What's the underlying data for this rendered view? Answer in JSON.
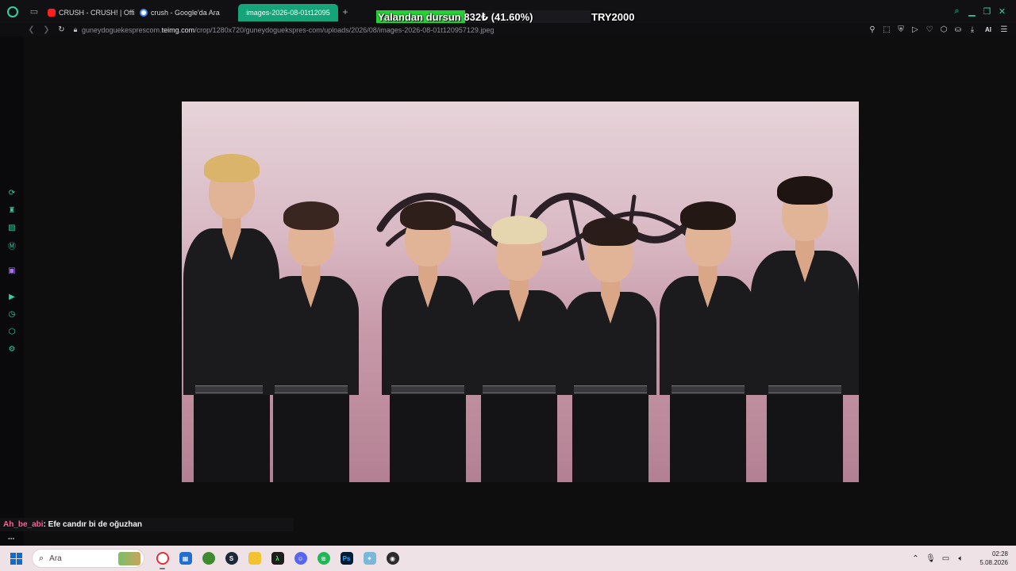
{
  "browser": {
    "tabs": [
      {
        "label": "CRUSH - CRUSH! | Official",
        "type": "yt",
        "active": false
      },
      {
        "label": "crush - Google'da Ara",
        "type": "google",
        "active": false
      },
      {
        "label": "images-2026-08-01t12095",
        "type": "image",
        "active": true
      }
    ],
    "new_tab_symbol": "+",
    "url_prefix": "guneydoguekesprescom.",
    "url_host": "teimg.com",
    "url_path": "/crop/1280x720/guneydoguekspres-com/uploads/2026/08/images-2026-08-01t120957129.jpeg",
    "ai_label": "AI"
  },
  "overlay": {
    "goal_text": "Yalandan dursun  832₺ (41.60%)",
    "goal_progress": 41.6,
    "goal_target": "TRY2000"
  },
  "chat": {
    "user": "Ah_be_abi",
    "message": " : Efe candır bi de oğuzhan",
    "more": "..."
  },
  "taskbar": {
    "search_placeholder": "Ara",
    "time": "02:28",
    "date": "5.08.2026"
  },
  "colors": {
    "accent": "#2fd1a0",
    "active_tab": "#15a47a",
    "goal_fill": "#25d135",
    "chat_user": "#ff5d8f"
  }
}
